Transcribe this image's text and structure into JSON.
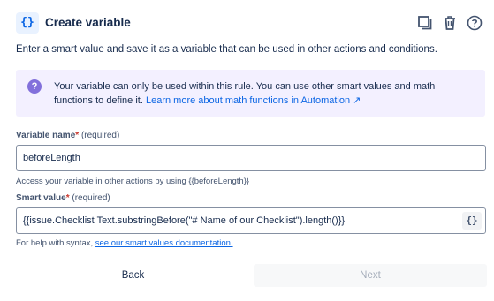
{
  "header": {
    "icon_glyph": "{}",
    "title": "Create variable",
    "actions": [
      {
        "name": "duplicate-icon"
      },
      {
        "name": "trash-icon"
      },
      {
        "name": "help-icon"
      }
    ]
  },
  "intro": "Enter a smart value and save it as a variable that can be used in other actions and conditions.",
  "info": {
    "icon_glyph": "?",
    "text": "Your variable can only be used within this rule. You can use other smart values and math functions to define it.",
    "link": "Learn more about math functions in Automation ↗"
  },
  "variable_name": {
    "label": "Variable name",
    "required_mark": "*",
    "required_text": "(required)",
    "value": "beforeLength",
    "helper": "Access your variable in other actions by using {{beforeLength}}"
  },
  "smart_value": {
    "label": "Smart value",
    "required_mark": "*",
    "required_text": "(required)",
    "value": "{{issue.Checklist Text.substringBefore(\"# Name of our Checklist\").length()}}",
    "button_glyph": "{}",
    "helper_prefix": "For help with syntax,",
    "helper_link": "see our smart values documentation."
  },
  "footer": {
    "back_label": "Back",
    "next_label": "Next"
  },
  "colors": {
    "accent": "#0c66e4",
    "info_bg": "#f3f0ff",
    "info_icon": "#8270db",
    "required": "#c9372c"
  }
}
